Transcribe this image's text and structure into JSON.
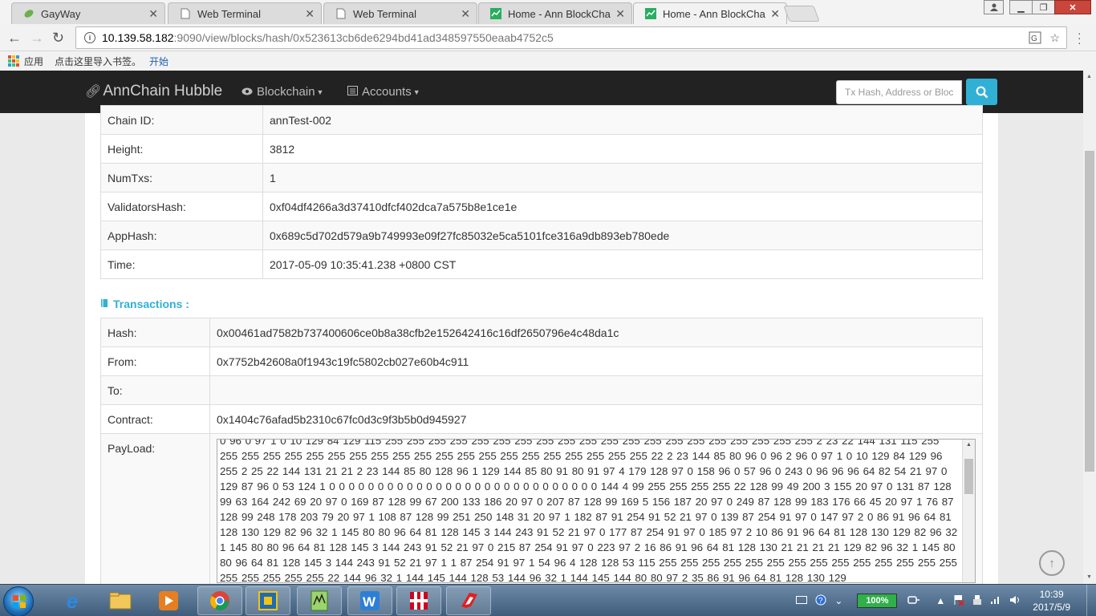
{
  "browser": {
    "tabs": [
      {
        "title": "GayWay",
        "icon": "leaf-icon"
      },
      {
        "title": "Web Terminal",
        "icon": "page-icon"
      },
      {
        "title": "Web Terminal",
        "icon": "page-icon"
      },
      {
        "title": "Home - Ann BlockChai",
        "icon": "chart-icon"
      },
      {
        "title": "Home - Ann BlockChai",
        "icon": "chart-icon",
        "active": true
      }
    ],
    "url_host": "10.139.58.182",
    "url_rest": ":9090/view/blocks/hash/0x523613cb6de6294bd41ad348597550eaab4752c5",
    "bookmarks": {
      "apps_label": "应用",
      "hint": "点击这里导入书签。",
      "start_link": "开始"
    }
  },
  "navbar": {
    "brand": "AnnChain Hubble",
    "blockchain_label": "Blockchain",
    "accounts_label": "Accounts",
    "search_placeholder": "Tx Hash, Address or Block"
  },
  "block": {
    "rows": [
      {
        "key": "Chain ID:",
        "value": "annTest-002"
      },
      {
        "key": "Height:",
        "value": "3812"
      },
      {
        "key": "NumTxs:",
        "value": "1"
      },
      {
        "key": "ValidatorsHash:",
        "value": "0xf04df4266a3d37410dfcf402dca7a575b8e1ce1e"
      },
      {
        "key": "AppHash:",
        "value": "0x689c5d702d579a9b749993e09f27fc85032e5ca5101fce316a9db893eb780ede"
      },
      {
        "key": "Time:",
        "value": "2017-05-09 10:35:41.238 +0800 CST"
      }
    ]
  },
  "transactions": {
    "heading": "Transactions :",
    "hash_label": "Hash:",
    "hash": "0x00461ad7582b737400606ce0b8a38cfb2e152642416c16df2650796e4c48da1c",
    "from_label": "From:",
    "from": "0x7752b42608a0f1943c19fc5802cb027e60b4c911",
    "to_label": "To:",
    "to": "",
    "contract_label": "Contract:",
    "contract": "0x1404c76afad5b2310c67fc0d3c9f3b5b0d945927",
    "payload_label": "PayLoad:",
    "payload": "0 96 0 97 1 0 10 129 84 129 115 255 255 255 255 255 255 255 255 255 255 255 255 255 255 255 255 255 255 255 255 2 23 22 144 131 115 255 255 255 255 255 255 255 255 255 255 255 255 255 255 255 255 255 255 255 255 255 22 2 23 144 85 80 96 0 96 2 96 0 97 1 0 10 129 84 129 96 255 2 25 22 144 131 21 21 2 23 144 85 80 128 96 1 129 144 85 80 91 80 91 97 4 179 128 97 0 158 96 0 57 96 0 243 0 96 96 96 64 82 54 21 97 0 129 87 96 0 53 124 1 0 0 0 0 0 0 0 0 0 0 0 0 0 0 0 0 0 0 0 0 0 0 0 0 0 0 0 0 144 4 99 255 255 255 255 22 128 99 49 200 3 155 20 97 0 131 87 128 99 63 164 242 69 20 97 0 169 87 128 99 67 200 133 186 20 97 0 207 87 128 99 169 5 156 187 20 97 0 249 87 128 99 183 176 66 45 20 97 1 76 87 128 99 248 178 203 79 20 97 1 108 87 128 99 251 250 148 31 20 97 1 182 87 91 254 91 52 21 97 0 139 87 254 91 97 0 147 97 2 0 86 91 96 64 81 128 130 129 82 96 32 1 145 80 80 96 64 81 128 145 3 144 243 91 52 21 97 0 177 87 254 91 97 0 185 97 2 10 86 91 96 64 81 128 130 129 82 96 32 1 145 80 80 96 64 81 128 145 3 144 243 91 52 21 97 0 215 87 254 91 97 0 223 97 2 16 86 91 96 64 81 128 130 21 21 21 21 129 82 96 32 1 145 80 80 96 64 81 128 145 3 144 243 91 52 21 97 1 1 87 254 91 97 1 54 96 4 128 128 53 115 255 255 255 255 255 255 255 255 255 255 255 255 255 255 255 255 255 255 255 22 144 96 32 1 144 145 144 128 53 144 96 32 1 144 145 144 80 80 97 2 35 86 91 96 64 81 128 130 129"
  },
  "taskbar": {
    "battery": "100%",
    "time": "10:39",
    "date": "2017/5/9"
  },
  "colors": {
    "accent": "#31b0d5",
    "navbar": "#222222",
    "close": "#c9463d"
  }
}
